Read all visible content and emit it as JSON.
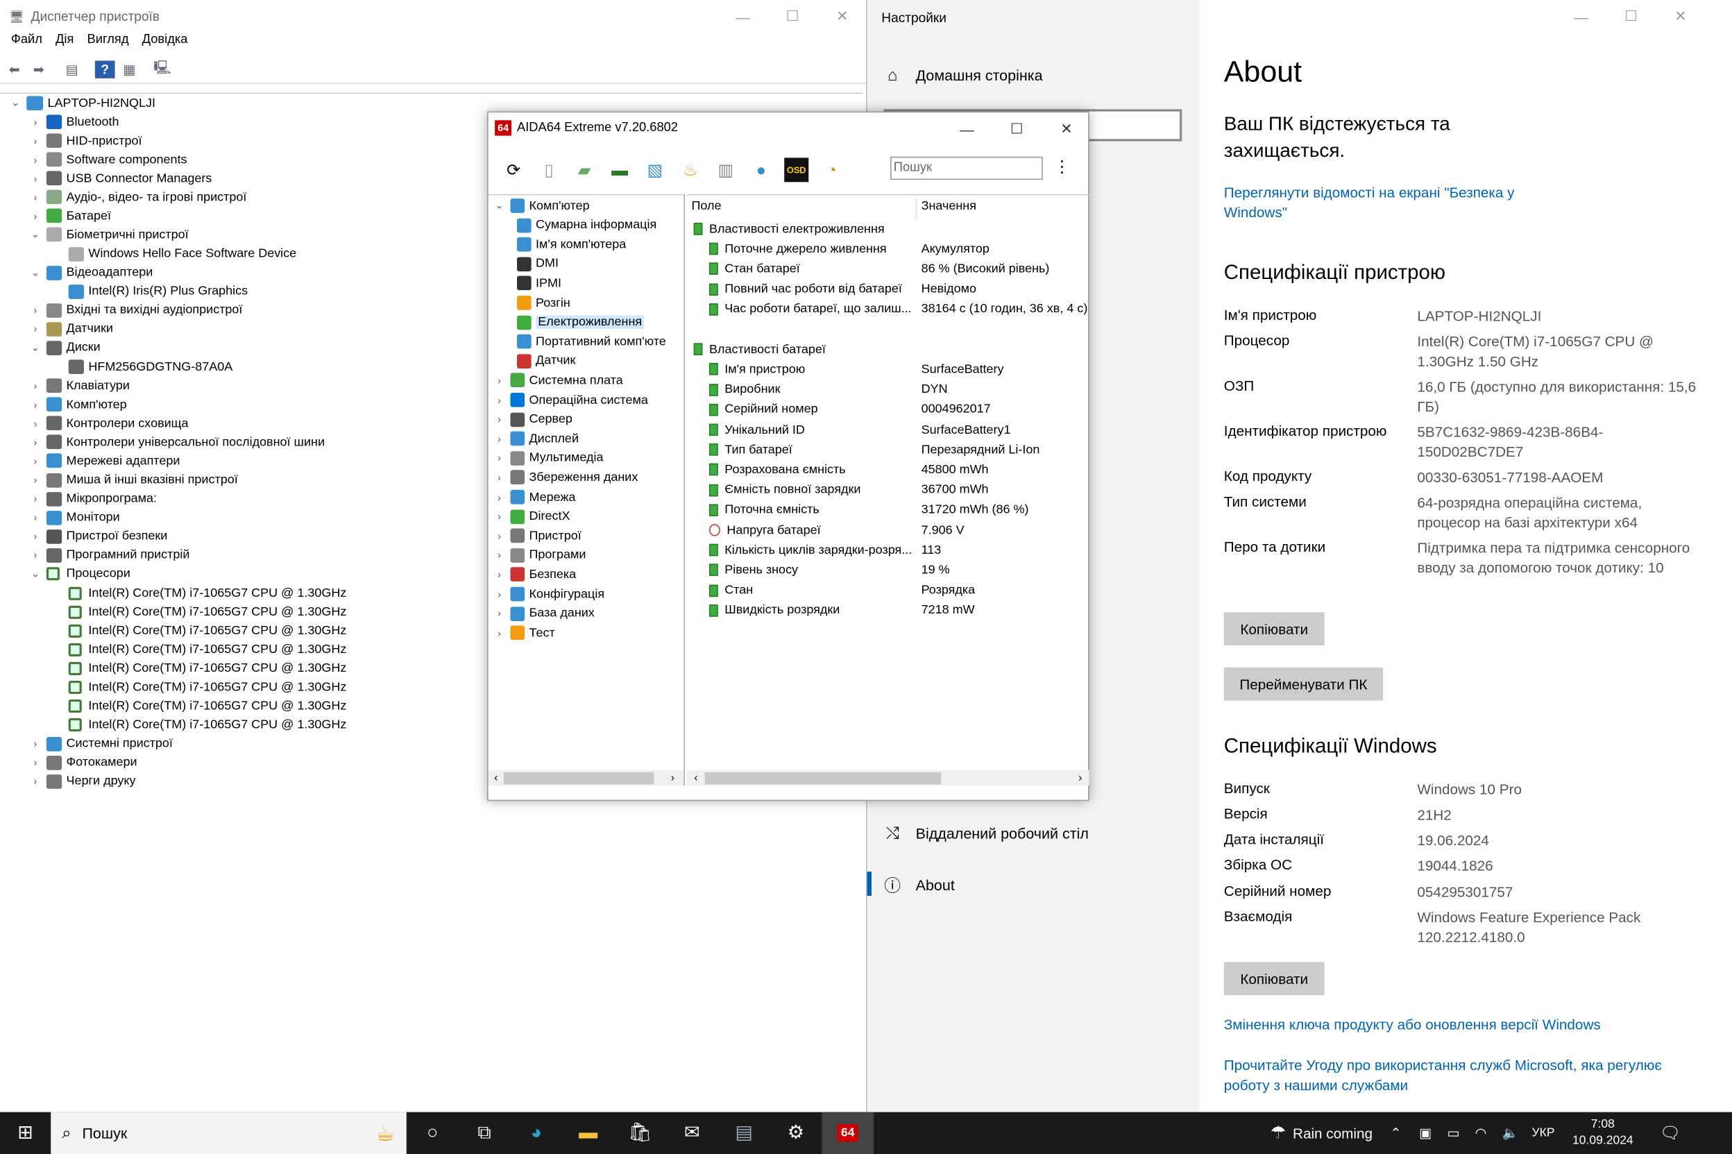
{
  "device_manager": {
    "title": "Диспетчер пристроїв",
    "menu": [
      "Файл",
      "Дія",
      "Вигляд",
      "Довідка"
    ],
    "root": "LAPTOP-HI2NQLJI",
    "items": [
      {
        "label": "Bluetooth",
        "lvl": 1,
        "exp": false,
        "icon": "bluetooth-icon",
        "color": "#1565c0"
      },
      {
        "label": "HID-пристрої",
        "lvl": 1,
        "exp": false,
        "icon": "hid-icon",
        "color": "#777"
      },
      {
        "label": "Software components",
        "lvl": 1,
        "exp": false,
        "icon": "puzzle-icon",
        "color": "#888"
      },
      {
        "label": "USB Connector Managers",
        "lvl": 1,
        "exp": false,
        "icon": "usb-icon",
        "color": "#666"
      },
      {
        "label": "Аудіо-, відео- та ігрові пристрої",
        "lvl": 1,
        "exp": false,
        "icon": "speaker-icon",
        "color": "#8a8"
      },
      {
        "label": "Батареї",
        "lvl": 1,
        "exp": false,
        "icon": "battery-icon",
        "color": "#4a4"
      },
      {
        "label": "Біометричні пристрої",
        "lvl": 1,
        "exp": true,
        "icon": "fingerprint-icon",
        "color": "#aaa"
      },
      {
        "label": "Windows Hello Face Software Device",
        "lvl": 2,
        "icon": "fingerprint-icon",
        "color": "#aaa"
      },
      {
        "label": "Відеоадаптери",
        "lvl": 1,
        "exp": true,
        "icon": "monitor-icon",
        "color": "#3a8fd0"
      },
      {
        "label": "Intel(R) Iris(R) Plus Graphics",
        "lvl": 2,
        "icon": "monitor-icon",
        "color": "#3a8fd0"
      },
      {
        "label": "Вхідні та вихідні аудіопристрої",
        "lvl": 1,
        "exp": false,
        "icon": "speaker-icon",
        "color": "#888"
      },
      {
        "label": "Датчики",
        "lvl": 1,
        "exp": false,
        "icon": "sensor-icon",
        "color": "#a95"
      },
      {
        "label": "Диски",
        "lvl": 1,
        "exp": true,
        "icon": "disk-icon",
        "color": "#666"
      },
      {
        "label": "HFM256GDGTNG-87A0A",
        "lvl": 2,
        "icon": "disk-icon",
        "color": "#666"
      },
      {
        "label": "Клавіатури",
        "lvl": 1,
        "exp": false,
        "icon": "keyboard-icon",
        "color": "#777"
      },
      {
        "label": "Комп'ютер",
        "lvl": 1,
        "exp": false,
        "icon": "computer-icon",
        "color": "#3a8fd0"
      },
      {
        "label": "Контролери сховища",
        "lvl": 1,
        "exp": false,
        "icon": "storage-icon",
        "color": "#666"
      },
      {
        "label": "Контролери універсальної послідовної шини",
        "lvl": 1,
        "exp": false,
        "icon": "usb-icon",
        "color": "#666"
      },
      {
        "label": "Мережеві адаптери",
        "lvl": 1,
        "exp": false,
        "icon": "network-icon",
        "color": "#3a8fd0"
      },
      {
        "label": "Миша й інші вказівні пристрої",
        "lvl": 1,
        "exp": false,
        "icon": "mouse-icon",
        "color": "#777"
      },
      {
        "label": "Мікропрограма:",
        "lvl": 1,
        "exp": false,
        "icon": "firmware-icon",
        "color": "#666"
      },
      {
        "label": "Монітори",
        "lvl": 1,
        "exp": false,
        "icon": "monitor-icon",
        "color": "#3a8fd0"
      },
      {
        "label": "Пристрої безпеки",
        "lvl": 1,
        "exp": false,
        "icon": "security-icon",
        "color": "#555"
      },
      {
        "label": "Програмний пристрій",
        "lvl": 1,
        "exp": false,
        "icon": "software-icon",
        "color": "#666"
      },
      {
        "label": "Процесори",
        "lvl": 1,
        "exp": true,
        "icon": "cpu-icon",
        "color": "#4a7a3a"
      },
      {
        "label": "Intel(R) Core(TM) i7-1065G7 CPU @ 1.30GHz",
        "lvl": 2,
        "icon": "cpu-icon",
        "color": "#4a7a3a"
      },
      {
        "label": "Intel(R) Core(TM) i7-1065G7 CPU @ 1.30GHz",
        "lvl": 2,
        "icon": "cpu-icon",
        "color": "#4a7a3a"
      },
      {
        "label": "Intel(R) Core(TM) i7-1065G7 CPU @ 1.30GHz",
        "lvl": 2,
        "icon": "cpu-icon",
        "color": "#4a7a3a"
      },
      {
        "label": "Intel(R) Core(TM) i7-1065G7 CPU @ 1.30GHz",
        "lvl": 2,
        "icon": "cpu-icon",
        "color": "#4a7a3a"
      },
      {
        "label": "Intel(R) Core(TM) i7-1065G7 CPU @ 1.30GHz",
        "lvl": 2,
        "icon": "cpu-icon",
        "color": "#4a7a3a"
      },
      {
        "label": "Intel(R) Core(TM) i7-1065G7 CPU @ 1.30GHz",
        "lvl": 2,
        "icon": "cpu-icon",
        "color": "#4a7a3a"
      },
      {
        "label": "Intel(R) Core(TM) i7-1065G7 CPU @ 1.30GHz",
        "lvl": 2,
        "icon": "cpu-icon",
        "color": "#4a7a3a"
      },
      {
        "label": "Intel(R) Core(TM) i7-1065G7 CPU @ 1.30GHz",
        "lvl": 2,
        "icon": "cpu-icon",
        "color": "#4a7a3a"
      },
      {
        "label": "Системні пристрої",
        "lvl": 1,
        "exp": false,
        "icon": "system-icon",
        "color": "#3a8fd0"
      },
      {
        "label": "Фотокамери",
        "lvl": 1,
        "exp": false,
        "icon": "camera-icon",
        "color": "#777"
      },
      {
        "label": "Черги друку",
        "lvl": 1,
        "exp": false,
        "icon": "printer-icon",
        "color": "#777"
      }
    ]
  },
  "aida": {
    "title": "AIDA64 Extreme v7.20.6802",
    "logo": "64",
    "search_placeholder": "Пошук",
    "col_field": "Поле",
    "col_value": "Значення",
    "tree": [
      {
        "label": "Комп'ютер",
        "lvl": 0,
        "exp": true,
        "icon": "computer-icon",
        "color": "#3a8fd0"
      },
      {
        "label": "Сумарна інформація",
        "lvl": 1,
        "icon": "summary-icon",
        "color": "#3a8fd0"
      },
      {
        "label": "Ім'я комп'ютера",
        "lvl": 1,
        "icon": "computer-name-icon",
        "color": "#3a8fd0"
      },
      {
        "label": "DMI",
        "lvl": 1,
        "icon": "dmi-icon",
        "color": "#333"
      },
      {
        "label": "IPMI",
        "lvl": 1,
        "icon": "ipmi-icon",
        "color": "#333"
      },
      {
        "label": "Розгін",
        "lvl": 1,
        "icon": "flame-icon",
        "color": "#f39c12"
      },
      {
        "label": "Електроживлення",
        "lvl": 1,
        "icon": "power-icon",
        "color": "#3fae3f",
        "sel": true
      },
      {
        "label": "Портативний комп'юте",
        "lvl": 1,
        "icon": "laptop-icon",
        "color": "#3a8fd0"
      },
      {
        "label": "Датчик",
        "lvl": 1,
        "icon": "gauge-icon",
        "color": "#c33"
      },
      {
        "label": "Системна плата",
        "lvl": 0,
        "exp": false,
        "icon": "motherboard-icon",
        "color": "#4a4"
      },
      {
        "label": "Операційна система",
        "lvl": 0,
        "exp": false,
        "icon": "windows-icon",
        "color": "#0078d7"
      },
      {
        "label": "Сервер",
        "lvl": 0,
        "exp": false,
        "icon": "server-icon",
        "color": "#555"
      },
      {
        "label": "Дисплей",
        "lvl": 0,
        "exp": false,
        "icon": "display-icon",
        "color": "#3a8fd0"
      },
      {
        "label": "Мультимедіа",
        "lvl": 0,
        "exp": false,
        "icon": "multimedia-icon",
        "color": "#888"
      },
      {
        "label": "Збереження даних",
        "lvl": 0,
        "exp": false,
        "icon": "storage-icon",
        "color": "#777"
      },
      {
        "label": "Мережа",
        "lvl": 0,
        "exp": false,
        "icon": "network-icon",
        "color": "#3a8fd0"
      },
      {
        "label": "DirectX",
        "lvl": 0,
        "exp": false,
        "icon": "directx-icon",
        "color": "#3fae3f"
      },
      {
        "label": "Пристрої",
        "lvl": 0,
        "exp": false,
        "icon": "devices-icon",
        "color": "#777"
      },
      {
        "label": "Програми",
        "lvl": 0,
        "exp": false,
        "icon": "programs-icon",
        "color": "#888"
      },
      {
        "label": "Безпека",
        "lvl": 0,
        "exp": false,
        "icon": "shield-icon",
        "color": "#c33"
      },
      {
        "label": "Конфігурація",
        "lvl": 0,
        "exp": false,
        "icon": "config-icon",
        "color": "#3a8fd0"
      },
      {
        "label": "База даних",
        "lvl": 0,
        "exp": false,
        "icon": "database-icon",
        "color": "#3a8fd0"
      },
      {
        "label": "Тест",
        "lvl": 0,
        "exp": false,
        "icon": "benchmark-icon",
        "color": "#f39c12"
      }
    ],
    "rows": [
      {
        "field": "Властивості електроживлення",
        "value": "",
        "group": true
      },
      {
        "field": "Поточне джерело живлення",
        "value": "Акумулятор"
      },
      {
        "field": "Стан батареї",
        "value": "86 % (Високий рівень)"
      },
      {
        "field": "Повний час роботи від батареї",
        "value": "Невідомо"
      },
      {
        "field": "Час роботи батареї, що залиш...",
        "value": "38164 с (10 годин, 36 хв, 4 с)"
      },
      {
        "field": "",
        "value": "",
        "blank": true
      },
      {
        "field": "Властивості батареї",
        "value": "",
        "group": true
      },
      {
        "field": "Ім'я пристрою",
        "value": "SurfaceBattery"
      },
      {
        "field": "Виробник",
        "value": "DYN"
      },
      {
        "field": "Серійний номер",
        "value": "0004962017"
      },
      {
        "field": "Унікальний ID",
        "value": "SurfaceBattery1"
      },
      {
        "field": "Тип батареї",
        "value": "Перезарядний Li-Ion"
      },
      {
        "field": "Розрахована ємність",
        "value": "45800 mWh"
      },
      {
        "field": "Ємність повної зарядки",
        "value": "36700 mWh"
      },
      {
        "field": "Поточна ємність",
        "value": "31720 mWh  (86 %)"
      },
      {
        "field": "Напруга батареї",
        "value": "7.906 V",
        "volt": true
      },
      {
        "field": "Кількість циклів зарядки-розря...",
        "value": "113"
      },
      {
        "field": "Рівень зносу",
        "value": "19 %"
      },
      {
        "field": "Стан",
        "value": "Розрядка"
      },
      {
        "field": "Швидкість розрядки",
        "value": "7218 mW"
      }
    ]
  },
  "settings": {
    "title": "Настройки",
    "home": "Домашня сторінка",
    "nav_remote": "Віддалений робочий стіл",
    "nav_about": "About",
    "heading": "About",
    "protected": "Ваш ПК відстежується та захищається.",
    "security_link": "Переглянути відомості на екрані \"Безпека у Windows\"",
    "device_specs_title": "Специфікації пристрою",
    "device_specs": [
      {
        "k": "Ім'я пристрою",
        "v": "LAPTOP-HI2NQLJI"
      },
      {
        "k": "Процесор",
        "v": "Intel(R) Core(TM) i7-1065G7 CPU @ 1.30GHz   1.50 GHz"
      },
      {
        "k": "ОЗП",
        "v": "16,0 ГБ (доступно для використання: 15,6 ГБ)"
      },
      {
        "k": "Ідентифікатор пристрою",
        "v": "5B7C1632-9869-423B-86B4-150D02BC7DE7"
      },
      {
        "k": "Код продукту",
        "v": "00330-63051-77198-AAOEM"
      },
      {
        "k": "Тип системи",
        "v": "64-розрядна операційна система, процесор на базі архітектури x64"
      },
      {
        "k": "Перо та дотики",
        "v": "Підтримка пера та підтримка сенсорного вводу за допомогою точок дотику: 10"
      }
    ],
    "copy_label": "Копіювати",
    "rename_label": "Перейменувати ПК",
    "win_specs_title": "Специфікації Windows",
    "win_specs": [
      {
        "k": "Випуск",
        "v": "Windows 10 Pro"
      },
      {
        "k": "Версія",
        "v": "21H2"
      },
      {
        "k": "Дата інсталяції",
        "v": "19.06.2024"
      },
      {
        "k": "Збірка ОС",
        "v": "19044.1826"
      },
      {
        "k": "Серійний номер",
        "v": "054295301757"
      },
      {
        "k": "Взаємодія",
        "v": "Windows Feature Experience Pack 120.2212.4180.0"
      }
    ],
    "copy_label2": "Копіювати",
    "link_product_key": "Змінення ключа продукту або оновлення версії Windows",
    "link_agreement": "Прочитайте Угоду про використання служб Microsoft, яка регулює роботу з нашими службами"
  },
  "taskbar": {
    "search": "Пошук",
    "weather": "Rain coming",
    "lang": "УКР",
    "time": "7:08",
    "date": "10.09.2024"
  }
}
